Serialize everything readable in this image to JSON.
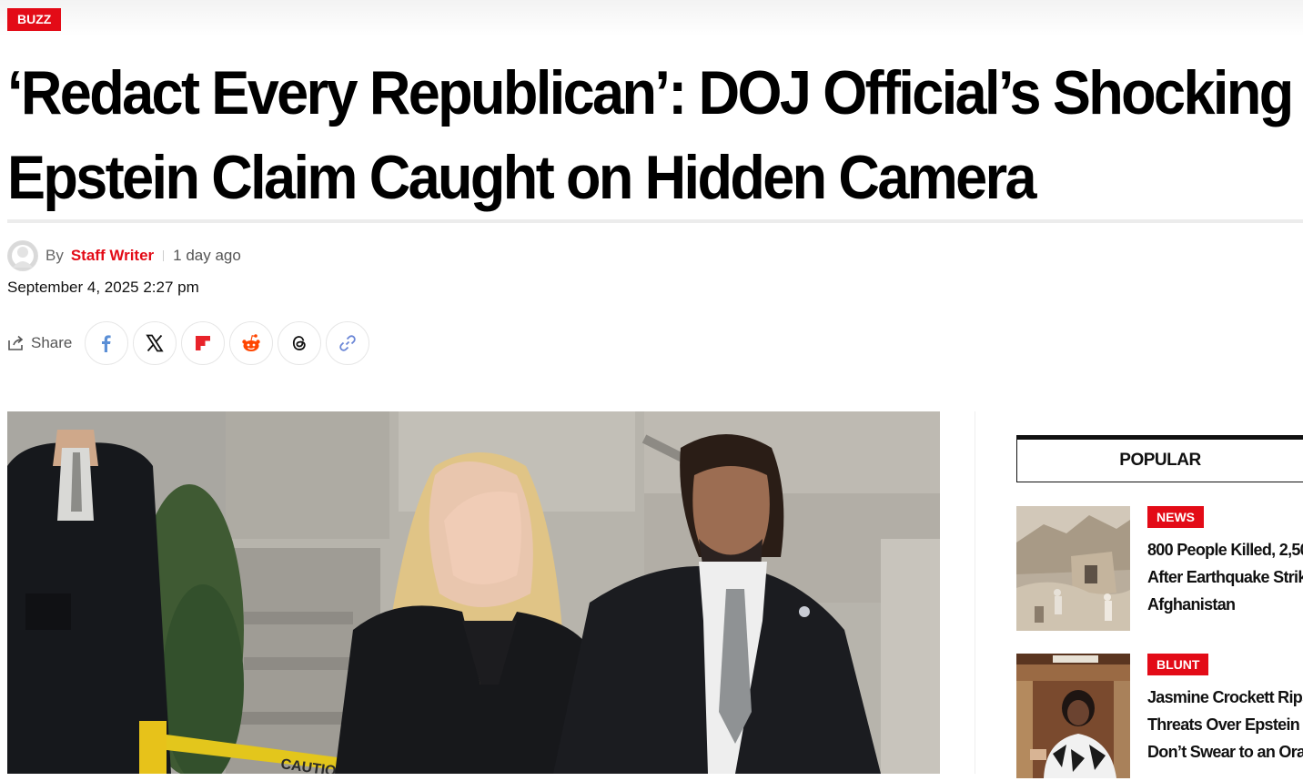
{
  "article": {
    "category": "BUZZ",
    "headline_line1": "‘Redact Every Republican’: DOJ Official’s Shocking",
    "headline_line2": "Epstein Claim Caught on Hidden Camera",
    "by": "By",
    "author": "Staff Writer",
    "time_ago": "1 day ago",
    "date": "September 4, 2025 2:27 pm"
  },
  "share": {
    "label": "Share",
    "buttons": [
      "facebook-icon",
      "x-icon",
      "flipboard-icon",
      "reddit-icon",
      "threads-icon",
      "link-icon"
    ]
  },
  "sidebar": {
    "heading": "POPULAR",
    "items": [
      {
        "category": "NEWS",
        "title": "800 People Killed, 2,50\nAfter Earthquake Strike\nAfghanistan"
      },
      {
        "category": "BLUNT",
        "title": "Jasmine Crockett Rips T\nThreats Over Epstein Vo\nDon’t Swear to an Orang"
      }
    ]
  },
  "hero_image": {
    "sign_text": "CAUTION"
  },
  "colors": {
    "accent": "#e30b17",
    "text": "#111111"
  }
}
